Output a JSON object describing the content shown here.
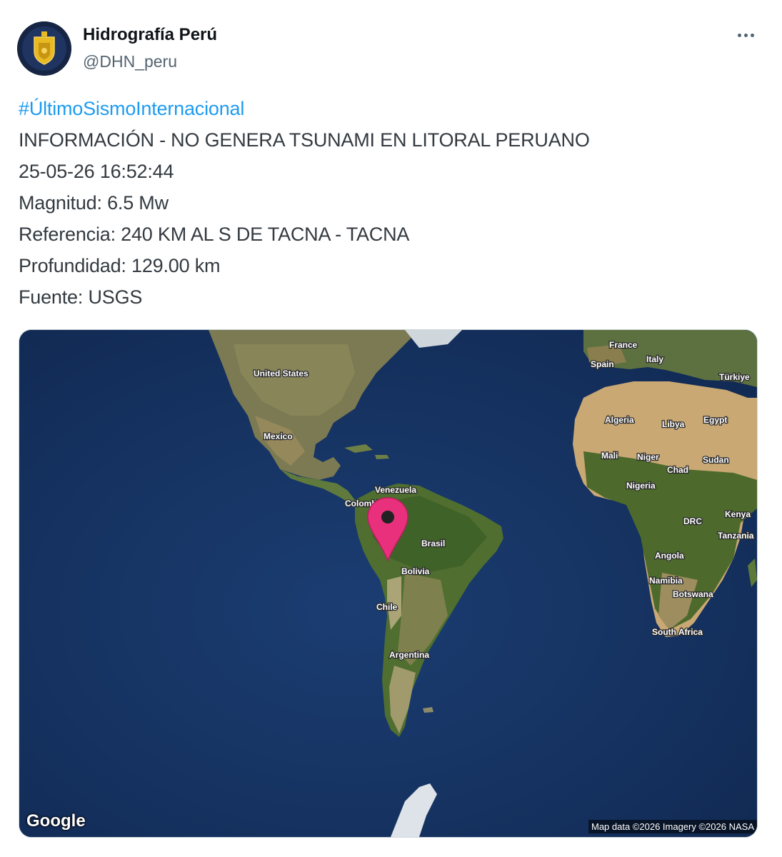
{
  "author": {
    "name": "Hidrografía Perú",
    "handle": "@DHN_peru"
  },
  "icons": {
    "more": "more-horizontal-icon",
    "marker": "map-pin-icon",
    "avatar": "navy-shield-logo"
  },
  "colors": {
    "hashtag": "#1d9bf0",
    "text": "#333a40",
    "handle": "#536471",
    "marker": "#e8307c"
  },
  "tweet": {
    "hashtag": "#ÚltimoSismoInternacional",
    "lines": [
      "INFORMACIÓN - NO GENERA TSUNAMI EN LITORAL PERUANO",
      "25-05-26 16:52:44",
      "Magnitud: 6.5 Mw",
      "Referencia: 240 KM AL S DE TACNA - TACNA",
      "Profundidad: 129.00 km",
      "Fuente: USGS"
    ]
  },
  "map": {
    "provider": "Google",
    "attribution": "Map data ©2026 Imagery ©2026 NASA",
    "labels": {
      "france": "France",
      "spain": "Spain",
      "italy": "Italy",
      "turkiye": "Türkiye",
      "united_states": "United States",
      "mexico": "Mexico",
      "algeria": "Algeria",
      "libya": "Libya",
      "egypt": "Egypt",
      "mali": "Mali",
      "niger": "Niger",
      "sudan": "Sudan",
      "chad": "Chad",
      "nigeria": "Nigeria",
      "venezuela": "Venezuela",
      "colombia": "Colombia",
      "brasil": "Brasil",
      "bolivia": "Bolivia",
      "chile": "Chile",
      "argentina": "Argentina",
      "drc": "DRC",
      "kenya": "Kenya",
      "tanzania": "Tanzania",
      "angola": "Angola",
      "namibia": "Namibia",
      "botswana": "Botswana",
      "south_africa": "South Africa"
    }
  }
}
